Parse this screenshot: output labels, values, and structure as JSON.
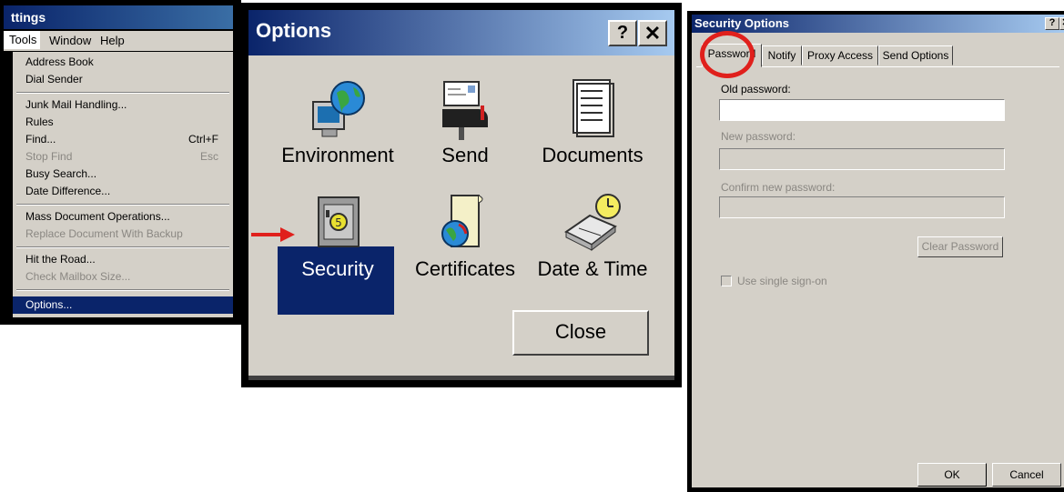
{
  "menu_panel": {
    "title": "ttings",
    "menubar": [
      "Tools",
      "Window",
      "Help"
    ],
    "items": [
      {
        "label": "Address Book",
        "shortcut": "",
        "disabled": false
      },
      {
        "label": "Dial Sender",
        "shortcut": "",
        "disabled": false
      },
      {
        "label": "Junk Mail Handling...",
        "shortcut": "",
        "disabled": false
      },
      {
        "label": "Rules",
        "shortcut": "",
        "disabled": false
      },
      {
        "label": "Find...",
        "shortcut": "Ctrl+F",
        "disabled": false
      },
      {
        "label": "Stop Find",
        "shortcut": "Esc",
        "disabled": true
      },
      {
        "label": "Busy Search...",
        "shortcut": "",
        "disabled": false
      },
      {
        "label": "Date Difference...",
        "shortcut": "",
        "disabled": false
      },
      {
        "label": "Mass Document Operations...",
        "shortcut": "",
        "disabled": false
      },
      {
        "label": "Replace Document With Backup",
        "shortcut": "",
        "disabled": true
      },
      {
        "label": "Hit the Road...",
        "shortcut": "",
        "disabled": false
      },
      {
        "label": "Check Mailbox Size...",
        "shortcut": "",
        "disabled": true
      },
      {
        "label": "Options...",
        "shortcut": "",
        "disabled": false,
        "selected": true
      }
    ]
  },
  "options_dialog": {
    "title": "Options",
    "help_label": "?",
    "close_x": "✕",
    "options": [
      "Environment",
      "Send",
      "Documents",
      "Security",
      "Certificates",
      "Date & Time"
    ],
    "selected": "Security",
    "close_button": "Close"
  },
  "security_dialog": {
    "title": "Security Options",
    "help_label": "?",
    "close_x": "✕",
    "tabs": [
      "Password",
      "Notify",
      "Proxy Access",
      "Send Options"
    ],
    "active_tab": "Password",
    "old_password_label": "Old password:",
    "new_password_label": "New password:",
    "confirm_password_label": "Confirm new password:",
    "old_password_value": "",
    "new_password_value": "",
    "confirm_password_value": "",
    "clear_password_button": "Clear Password",
    "single_signon_label": "Use single sign-on",
    "single_signon_checked": false,
    "ok_button": "OK",
    "cancel_button": "Cancel"
  },
  "colors": {
    "title_bar": "#0a246a",
    "dialog_face": "#d4d0c8",
    "highlight_circle": "#e0201c",
    "arrow": "#e0201c"
  }
}
